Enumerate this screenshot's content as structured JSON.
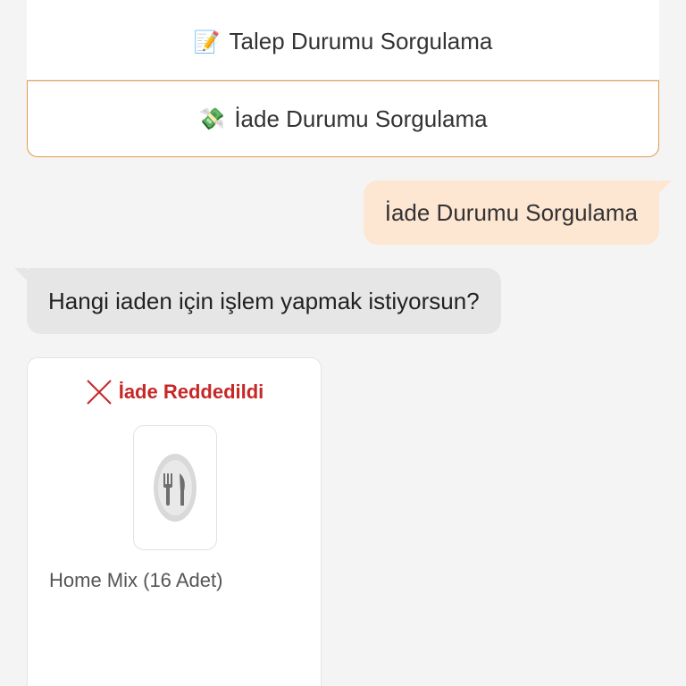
{
  "options": [
    {
      "emoji": "📝",
      "label": "Talep Durumu Sorgulama"
    },
    {
      "emoji": "💸",
      "label": "İade Durumu Sorgulama"
    }
  ],
  "messages": {
    "user": "İade Durumu Sorgulama",
    "bot": "Hangi iaden için işlem yapmak istiyorsun?"
  },
  "return_card": {
    "status": "İade Reddedildi",
    "status_icon": "close-x-icon",
    "image_icon": "plate-cutlery-icon",
    "product": "Home Mix (16 Adet)"
  },
  "colors": {
    "background": "#f4f4f4",
    "accent_border": "#e09a4f",
    "user_bubble": "#fde6d2",
    "bot_bubble": "#e6e6e6",
    "status_red": "#c62828"
  }
}
